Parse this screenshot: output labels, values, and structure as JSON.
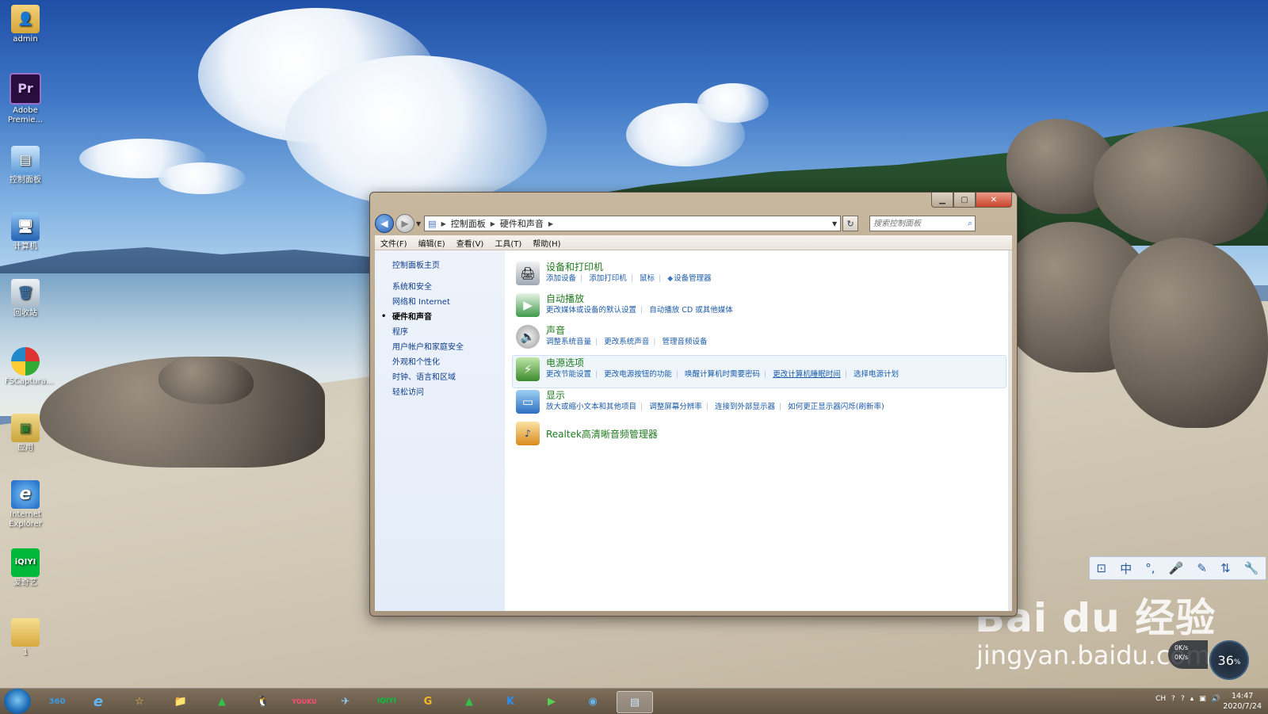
{
  "desktop": {
    "icons": [
      {
        "label": "admin",
        "icon": "user-folder-icon"
      },
      {
        "label": "Adobe Premie...",
        "icon": "premiere-icon",
        "glyph": "Pr"
      },
      {
        "label": "控制面板",
        "icon": "control-panel-icon"
      },
      {
        "label": "计算机",
        "icon": "computer-icon"
      },
      {
        "label": "回收站",
        "icon": "recycle-bin-icon"
      },
      {
        "label": "FSCaptura...",
        "icon": "fscapture-icon"
      },
      {
        "label": "应用",
        "icon": "apps-folder-icon"
      },
      {
        "label": "Internet Explorer",
        "icon": "ie-icon",
        "glyph": "e"
      },
      {
        "label": "爱奇艺",
        "icon": "iqiyi-icon",
        "glyph": "iQIYI"
      },
      {
        "label": "1",
        "icon": "folder-icon"
      }
    ]
  },
  "window": {
    "breadcrumb": [
      "控制面板",
      "硬件和声音"
    ],
    "search_placeholder": "搜索控制面板",
    "menu": [
      "文件(F)",
      "编辑(E)",
      "查看(V)",
      "工具(T)",
      "帮助(H)"
    ],
    "sidebar": {
      "home": "控制面板主页",
      "items": [
        "系统和安全",
        "网络和 Internet",
        "硬件和声音",
        "程序",
        "用户帐户和家庭安全",
        "外观和个性化",
        "时钟、语言和区域",
        "轻松访问"
      ],
      "active": "硬件和声音"
    },
    "categories": [
      {
        "title": "设备和打印机",
        "icon": "printer-icon",
        "links": [
          "添加设备",
          "添加打印机",
          "鼠标",
          "设备管理器"
        ]
      },
      {
        "title": "自动播放",
        "icon": "autoplay-icon",
        "links": [
          "更改媒体或设备的默认设置",
          "自动播放 CD 或其他媒体"
        ]
      },
      {
        "title": "声音",
        "icon": "speaker-icon",
        "links": [
          "调整系统音量",
          "更改系统声音",
          "管理音频设备"
        ]
      },
      {
        "title": "电源选项",
        "icon": "power-icon",
        "links": [
          "更改节能设置",
          "更改电源按钮的功能",
          "唤醒计算机时需要密码",
          "更改计算机睡眠时间",
          "选择电源计划"
        ]
      },
      {
        "title": "显示",
        "icon": "display-icon",
        "links": [
          "放大或缩小文本和其他项目",
          "调整屏幕分辨率",
          "连接到外部显示器",
          "如何更正显示器闪烁(刷新率)"
        ]
      },
      {
        "title": "Realtek高清晰音频管理器",
        "icon": "realtek-icon",
        "links": []
      }
    ]
  },
  "langbar": {
    "items": [
      "中",
      "°,",
      "🎤",
      "✎",
      "⇅",
      "🔧"
    ]
  },
  "netspeed": {
    "up": "0K/s",
    "down": "0K/s",
    "percent": "36",
    "unit": "%"
  },
  "watermark": {
    "logo": "Bai du 经验",
    "url": "jingyan.baidu.com"
  },
  "taskbar": {
    "items": [
      "360",
      "e",
      "☆",
      "📁",
      "▲",
      "🐧",
      "YOUKU",
      "✈",
      "iQIYI",
      "G",
      "▲",
      "K",
      "▶",
      "◉",
      "▤"
    ],
    "active_index": 14,
    "tray": [
      "CH",
      "?",
      "?",
      "▴",
      "▣",
      "🔊"
    ],
    "time": "14:47",
    "date": "2020/7/24"
  }
}
